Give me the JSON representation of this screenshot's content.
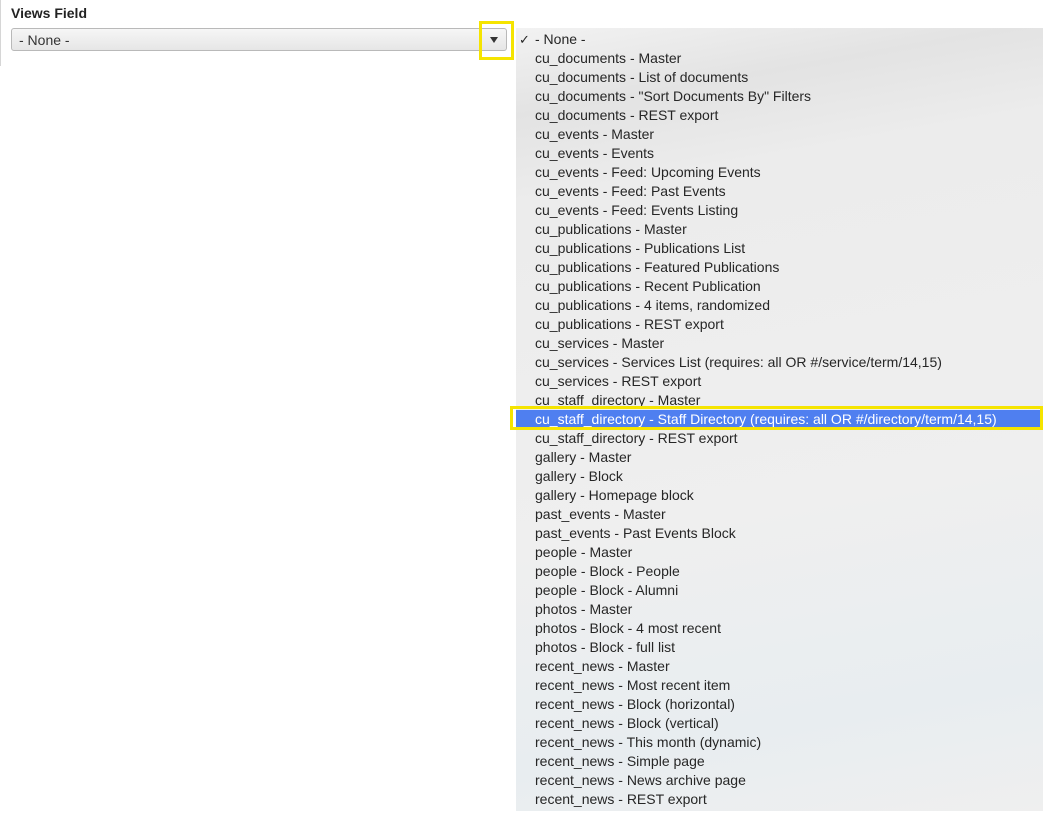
{
  "field": {
    "label": "Views Field",
    "selected_value": "- None -"
  },
  "dropdown": {
    "check_glyph": "✓",
    "selected_index": 0,
    "hovered_index": 20,
    "hover_color": "#4f7ff0",
    "highlight_outline_color": "#f5e400",
    "options": [
      "- None -",
      "cu_documents - Master",
      "cu_documents - List of documents",
      "cu_documents - \"Sort Documents By\" Filters",
      "cu_documents - REST export",
      "cu_events - Master",
      "cu_events - Events",
      "cu_events - Feed: Upcoming Events",
      "cu_events - Feed: Past Events",
      "cu_events - Feed: Events Listing",
      "cu_publications - Master",
      "cu_publications - Publications List",
      "cu_publications - Featured Publications",
      "cu_publications - Recent Publication",
      "cu_publications - 4 items, randomized",
      "cu_publications - REST export",
      "cu_services - Master",
      "cu_services - Services List (requires: all OR #/service/term/14,15)",
      "cu_services - REST export",
      "cu_staff_directory - Master",
      "cu_staff_directory - Staff Directory (requires: all OR #/directory/term/14,15)",
      "cu_staff_directory - REST export",
      "gallery - Master",
      "gallery - Block",
      "gallery - Homepage block",
      "past_events - Master",
      "past_events - Past Events Block",
      "people - Master",
      "people - Block - People",
      "people - Block - Alumni",
      "photos - Master",
      "photos - Block - 4 most recent",
      "photos - Block - full list",
      "recent_news - Master",
      "recent_news - Most recent item",
      "recent_news - Block (horizontal)",
      "recent_news - Block (vertical)",
      "recent_news - This month (dynamic)",
      "recent_news - Simple page",
      "recent_news - News archive page",
      "recent_news - REST export"
    ]
  }
}
